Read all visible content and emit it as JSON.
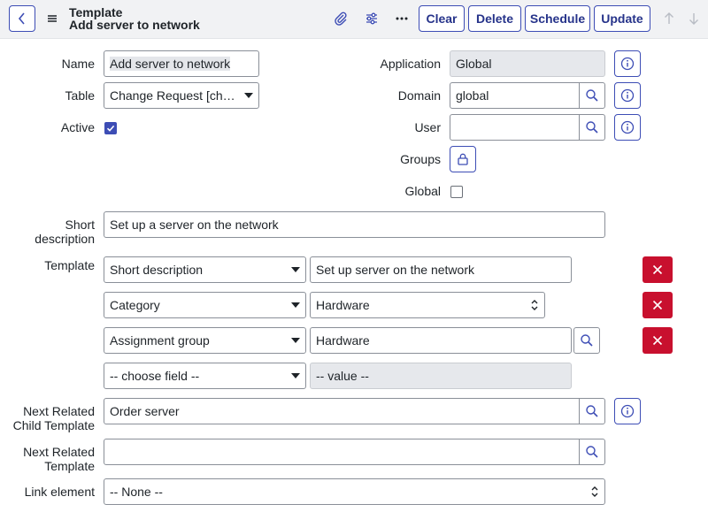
{
  "header": {
    "title_top": "Template",
    "title_bottom": "Add server to network",
    "icons": [
      "back-icon",
      "hamburger-icon",
      "paperclip-icon",
      "sliders-icon",
      "more-icon",
      "arrow-up-icon",
      "arrow-down-icon"
    ],
    "buttons": {
      "clear": "Clear",
      "delete": "Delete",
      "schedule": "Schedule",
      "update": "Update"
    }
  },
  "form": {
    "name": {
      "label": "Name",
      "value": "Add server to network"
    },
    "table": {
      "label": "Table",
      "value": "Change Request [chan..."
    },
    "active": {
      "label": "Active",
      "checked": true
    },
    "application": {
      "label": "Application",
      "value": "Global"
    },
    "domain": {
      "label": "Domain",
      "value": "global"
    },
    "user": {
      "label": "User",
      "value": ""
    },
    "groups": {
      "label": "Groups"
    },
    "global": {
      "label": "Global",
      "checked": false
    },
    "short_description": {
      "label_line1": "Short",
      "label_line2": "description",
      "value": "Set up a server on the network"
    },
    "template": {
      "label": "Template",
      "rows": [
        {
          "field": "Short description",
          "value": "Set up server on the network"
        },
        {
          "field": "Category",
          "value": "Hardware"
        },
        {
          "field": "Assignment group",
          "value": "Hardware"
        },
        {
          "field": "-- choose field --",
          "value": "-- value --"
        }
      ]
    },
    "next_related_child": {
      "label_line1": "Next Related",
      "label_line2": "Child Template",
      "value": "Order server"
    },
    "next_related_template": {
      "label_line1": "Next Related",
      "label_line2": "Template",
      "value": ""
    },
    "link_element": {
      "label": "Link element",
      "value": "-- None --"
    }
  },
  "colors": {
    "primary": "#3d4db5",
    "danger": "#c8102e",
    "header_bg": "#f1f2f4",
    "readonly_bg": "#e6e8ec"
  }
}
